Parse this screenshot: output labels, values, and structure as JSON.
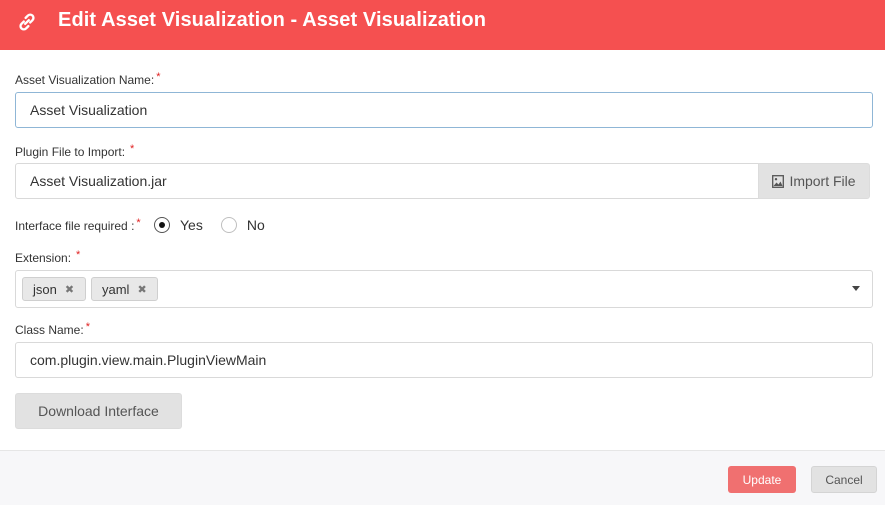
{
  "header": {
    "title": "Edit Asset Visualization - Asset Visualization",
    "icon": "link-icon",
    "background": "#f55050"
  },
  "form": {
    "name": {
      "label": "Asset Visualization Name:",
      "required_mark": "*",
      "value": "Asset Visualization"
    },
    "plugin_file": {
      "label": "Plugin File to Import:",
      "required_mark": "*",
      "value": "Asset Visualization.jar",
      "button_label": "Import File",
      "button_icon": "image-file-icon"
    },
    "interface_required": {
      "label": "Interface file required :",
      "required_mark": "*",
      "options": [
        "Yes",
        "No"
      ],
      "selected": "Yes"
    },
    "extension": {
      "label": "Extension:",
      "required_mark": "*",
      "tags": [
        "json",
        "yaml"
      ],
      "remove_glyph": "✖",
      "dropdown_icon": "caret-down-icon"
    },
    "class_name": {
      "label": "Class Name:",
      "required_mark": "*",
      "value": "com.plugin.view.main.PluginViewMain"
    },
    "download_button": "Download Interface"
  },
  "footer": {
    "update_label": "Update",
    "cancel_label": "Cancel",
    "update_color": "#f07070"
  }
}
